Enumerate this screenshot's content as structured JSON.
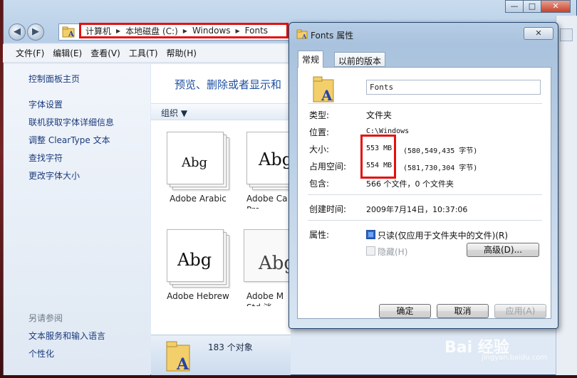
{
  "window": {
    "title_controls": {
      "minimize": "—",
      "maximize": "□",
      "close": "✕"
    }
  },
  "address": {
    "crumbs": [
      "计算机",
      "本地磁盘 (C:)",
      "Windows",
      "Fonts"
    ],
    "separator": "▶"
  },
  "menu": [
    "文件(F)",
    "编辑(E)",
    "查看(V)",
    "工具(T)",
    "帮助(H)"
  ],
  "sidebar": {
    "home": "控制面板主页",
    "links": [
      "字体设置",
      "联机获取字体详细信息",
      "调整 ClearType 文本",
      "查找字符",
      "更改字体大小"
    ],
    "see_also_heading": "另请参阅",
    "see_also": [
      "文本服务和输入语言",
      "个性化"
    ]
  },
  "main": {
    "title": "预览、删除或者显示和",
    "organize": "组织",
    "tiles": [
      {
        "glyph": "Abg",
        "label": "Adobe Arabic"
      },
      {
        "glyph": "Abg",
        "label": "Adobe Ca\nPro"
      },
      {
        "glyph": "Abg",
        "label": "Adobe Hebrew"
      },
      {
        "glyph": "Abg",
        "label": "Adobe M\nStd 淡"
      }
    ],
    "status": "183 个对象"
  },
  "dialog": {
    "title": "Fonts 属性",
    "close": "✕",
    "tabs": [
      "常规",
      "以前的版本"
    ],
    "name": "Fonts",
    "type_label": "类型:",
    "type_value": "文件夹",
    "location_label": "位置:",
    "location_value": "C:\\Windows",
    "size_label": "大小:",
    "size_short": "553 MB",
    "size_bytes": "(580,549,435 字节)",
    "disk_label": "占用空间:",
    "disk_short": "554 MB",
    "disk_bytes": "(581,730,304 字节)",
    "contains_label": "包含:",
    "contains_value": "566 个文件，0 个文件夹",
    "created_label": "创建时间:",
    "created_value": "2009年7月14日，10:37:06",
    "attributes_label": "属性:",
    "readonly_label": "只读(仅应用于文件夹中的文件)(R)",
    "hidden_label": "隐藏(H)",
    "advanced_button": "高级(D)...",
    "ok_button": "确定",
    "cancel_button": "取消",
    "apply_button": "应用(A)"
  },
  "watermark": {
    "brand": "Bai 经验",
    "url": "jingyan.baidu.com"
  },
  "colors": {
    "highlight_box": "#e41010",
    "link": "#1a3a7c",
    "title_blue": "#1e4fa3"
  }
}
